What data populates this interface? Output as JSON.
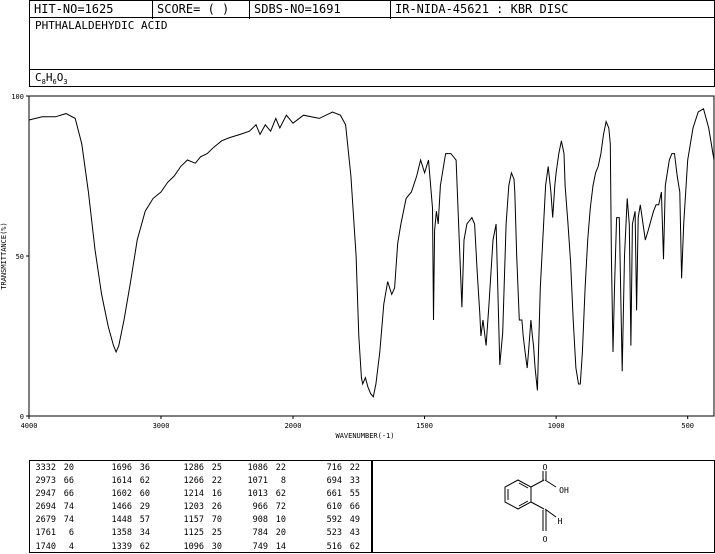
{
  "header": {
    "hit_no": "HIT-NO=1625",
    "score": "SCORE=  (   )",
    "sdbs_no": "SDBS-NO=1691",
    "ir_info": "IR-NIDA-45621 : KBR DISC"
  },
  "compound_name": "PHTHALALDEHYDIC ACID",
  "formula": {
    "c": "C",
    "c_n": "8",
    "h": "H",
    "h_n": "6",
    "o": "O",
    "o_n": "3"
  },
  "structure_labels": {
    "o_top": "O",
    "oh": "OH",
    "h": "H",
    "o_bottom": "O"
  },
  "chart_data": {
    "type": "line",
    "xlabel": "WAVENUMBER(-1)",
    "ylabel": "TRANSMITTANCE(%)",
    "xlim": [
      4000,
      400
    ],
    "ylim": [
      0,
      100
    ],
    "x_ticks": [
      4000,
      3000,
      2000,
      1500,
      1000,
      500
    ],
    "y_ticks": [
      0,
      50,
      100
    ],
    "x_tick_labels": [
      "4000",
      "3000",
      "2000",
      "1500",
      "1000",
      "500"
    ],
    "y_tick_labels": [
      "0",
      "50",
      "100"
    ],
    "series": [
      {
        "points": [
          [
            4000,
            92.5
          ],
          [
            3900,
            93.5
          ],
          [
            3800,
            93.5
          ],
          [
            3720,
            94.5
          ],
          [
            3650,
            93
          ],
          [
            3600,
            85
          ],
          [
            3550,
            70
          ],
          [
            3500,
            52
          ],
          [
            3450,
            38
          ],
          [
            3400,
            28
          ],
          [
            3360,
            22
          ],
          [
            3340,
            20
          ],
          [
            3320,
            22
          ],
          [
            3280,
            30
          ],
          [
            3230,
            42
          ],
          [
            3180,
            55
          ],
          [
            3120,
            64
          ],
          [
            3060,
            68
          ],
          [
            3000,
            70
          ],
          [
            2950,
            73
          ],
          [
            2900,
            75
          ],
          [
            2850,
            78
          ],
          [
            2800,
            80
          ],
          [
            2740,
            79
          ],
          [
            2700,
            81
          ],
          [
            2650,
            82
          ],
          [
            2600,
            84
          ],
          [
            2540,
            86
          ],
          [
            2480,
            87
          ],
          [
            2400,
            88
          ],
          [
            2330,
            89
          ],
          [
            2280,
            91
          ],
          [
            2250,
            88
          ],
          [
            2210,
            91
          ],
          [
            2170,
            89
          ],
          [
            2130,
            93
          ],
          [
            2100,
            90
          ],
          [
            2050,
            94
          ],
          [
            2000,
            91.5
          ],
          [
            1960,
            94
          ],
          [
            1900,
            93
          ],
          [
            1850,
            95
          ],
          [
            1820,
            94
          ],
          [
            1800,
            91
          ],
          [
            1780,
            75
          ],
          [
            1760,
            50
          ],
          [
            1750,
            25
          ],
          [
            1740,
            12
          ],
          [
            1735,
            10
          ],
          [
            1725,
            12
          ],
          [
            1715,
            9
          ],
          [
            1705,
            7
          ],
          [
            1695,
            6
          ],
          [
            1685,
            10
          ],
          [
            1670,
            20
          ],
          [
            1655,
            35
          ],
          [
            1640,
            42
          ],
          [
            1625,
            38
          ],
          [
            1614,
            40
          ],
          [
            1602,
            54
          ],
          [
            1590,
            60
          ],
          [
            1570,
            68
          ],
          [
            1550,
            70
          ],
          [
            1530,
            75
          ],
          [
            1515,
            80
          ],
          [
            1500,
            76
          ],
          [
            1485,
            80
          ],
          [
            1470,
            65
          ],
          [
            1466,
            30
          ],
          [
            1462,
            58
          ],
          [
            1455,
            64
          ],
          [
            1448,
            60
          ],
          [
            1440,
            72
          ],
          [
            1420,
            82
          ],
          [
            1400,
            82
          ],
          [
            1380,
            80
          ],
          [
            1358,
            34
          ],
          [
            1350,
            55
          ],
          [
            1339,
            60
          ],
          [
            1320,
            62
          ],
          [
            1310,
            60
          ],
          [
            1300,
            45
          ],
          [
            1290,
            32
          ],
          [
            1286,
            25
          ],
          [
            1278,
            30
          ],
          [
            1266,
            22
          ],
          [
            1255,
            35
          ],
          [
            1240,
            55
          ],
          [
            1228,
            60
          ],
          [
            1214,
            16
          ],
          [
            1203,
            26
          ],
          [
            1190,
            60
          ],
          [
            1180,
            72
          ],
          [
            1170,
            76
          ],
          [
            1160,
            74
          ],
          [
            1157,
            70
          ],
          [
            1150,
            50
          ],
          [
            1140,
            30
          ],
          [
            1130,
            30
          ],
          [
            1125,
            25
          ],
          [
            1118,
            20
          ],
          [
            1110,
            15
          ],
          [
            1105,
            20
          ],
          [
            1096,
            30
          ],
          [
            1090,
            25
          ],
          [
            1086,
            22
          ],
          [
            1080,
            15
          ],
          [
            1071,
            8
          ],
          [
            1060,
            40
          ],
          [
            1040,
            72
          ],
          [
            1030,
            78
          ],
          [
            1020,
            70
          ],
          [
            1013,
            62
          ],
          [
            1005,
            72
          ],
          [
            1000,
            76
          ],
          [
            990,
            82
          ],
          [
            980,
            86
          ],
          [
            970,
            82
          ],
          [
            966,
            72
          ],
          [
            955,
            60
          ],
          [
            945,
            48
          ],
          [
            935,
            30
          ],
          [
            925,
            15
          ],
          [
            915,
            10
          ],
          [
            908,
            10
          ],
          [
            900,
            20
          ],
          [
            890,
            40
          ],
          [
            880,
            55
          ],
          [
            870,
            65
          ],
          [
            860,
            72
          ],
          [
            850,
            76
          ],
          [
            840,
            78
          ],
          [
            830,
            82
          ],
          [
            820,
            88
          ],
          [
            810,
            92
          ],
          [
            800,
            90
          ],
          [
            794,
            85
          ],
          [
            790,
            50
          ],
          [
            784,
            20
          ],
          [
            778,
            40
          ],
          [
            770,
            62
          ],
          [
            760,
            62
          ],
          [
            749,
            14
          ],
          [
            740,
            50
          ],
          [
            730,
            68
          ],
          [
            722,
            60
          ],
          [
            716,
            22
          ],
          [
            710,
            60
          ],
          [
            700,
            64
          ],
          [
            694,
            33
          ],
          [
            688,
            62
          ],
          [
            680,
            66
          ],
          [
            661,
            55
          ],
          [
            650,
            58
          ],
          [
            630,
            64
          ],
          [
            620,
            66
          ],
          [
            610,
            66
          ],
          [
            600,
            70
          ],
          [
            592,
            49
          ],
          [
            585,
            72
          ],
          [
            570,
            80
          ],
          [
            560,
            82
          ],
          [
            550,
            82
          ],
          [
            540,
            75
          ],
          [
            530,
            70
          ],
          [
            523,
            43
          ],
          [
            515,
            60
          ],
          [
            500,
            80
          ],
          [
            480,
            90
          ],
          [
            460,
            95
          ],
          [
            440,
            96
          ],
          [
            420,
            90
          ],
          [
            400,
            80
          ]
        ]
      }
    ],
    "colors": {
      "line": "#000000",
      "grid": "#000000"
    }
  },
  "peak_table": {
    "columns": [
      [
        [
          "3332",
          "20"
        ],
        [
          "2973",
          "66"
        ],
        [
          "2947",
          "66"
        ],
        [
          "2694",
          "74"
        ],
        [
          "2679",
          "74"
        ],
        [
          "1761",
          "6"
        ],
        [
          "1740",
          "4"
        ]
      ],
      [
        [
          "1696",
          "36"
        ],
        [
          "1614",
          "62"
        ],
        [
          "1602",
          "60"
        ],
        [
          "1466",
          "29"
        ],
        [
          "1448",
          "57"
        ],
        [
          "1358",
          "34"
        ],
        [
          "1339",
          "62"
        ]
      ],
      [
        [
          "1286",
          "25"
        ],
        [
          "1266",
          "22"
        ],
        [
          "1214",
          "16"
        ],
        [
          "1203",
          "26"
        ],
        [
          "1157",
          "70"
        ],
        [
          "1125",
          "25"
        ],
        [
          "1096",
          "30"
        ]
      ],
      [
        [
          "1086",
          "22"
        ],
        [
          "1071",
          "8"
        ],
        [
          "1013",
          "62"
        ],
        [
          "966",
          "72"
        ],
        [
          "908",
          "10"
        ],
        [
          "784",
          "20"
        ],
        [
          "749",
          "14"
        ]
      ],
      [
        [
          "716",
          "22"
        ],
        [
          "694",
          "33"
        ],
        [
          "661",
          "55"
        ],
        [
          "610",
          "66"
        ],
        [
          "592",
          "49"
        ],
        [
          "523",
          "43"
        ],
        [
          "516",
          "62"
        ]
      ]
    ]
  }
}
